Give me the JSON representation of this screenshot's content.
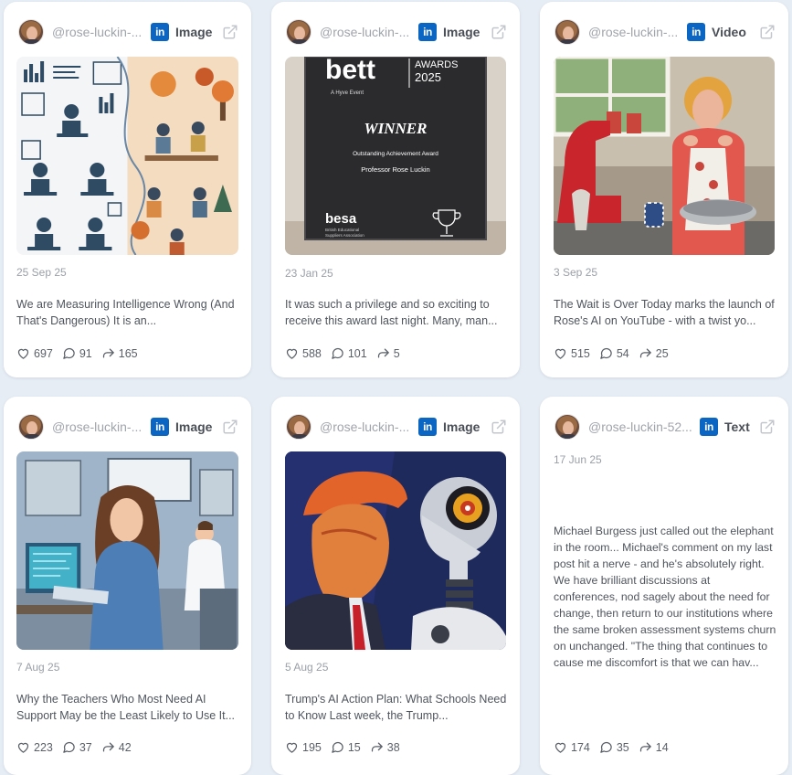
{
  "cards": [
    {
      "handle": "@rose-luckin-...",
      "platform_icon": "linkedin-icon",
      "type": "Image",
      "date": "25 Sep 25",
      "excerpt": "We are Measuring Intelligence Wrong (And That's Dangerous) It is an...",
      "likes": "697",
      "comments": "91",
      "shares": "165"
    },
    {
      "handle": "@rose-luckin-...",
      "platform_icon": "linkedin-icon",
      "type": "Image",
      "date": "23 Jan 25",
      "excerpt": "It was such a privilege and so exciting to receive this award last night. Many, man...",
      "likes": "588",
      "comments": "101",
      "shares": "5",
      "image_text": {
        "brand": "bett",
        "awards": "AWARDS",
        "year": "2025",
        "event": "A Hyve Event",
        "winner": "WINNER",
        "award": "Outstanding Achievement Award",
        "name": "Professor Rose Luckin",
        "sponsor": "besa",
        "sponsor_sub1": "British Educational",
        "sponsor_sub2": "Suppliers Association"
      }
    },
    {
      "handle": "@rose-luckin-...",
      "platform_icon": "linkedin-icon",
      "type": "Video",
      "date": "3 Sep 25",
      "excerpt": "The Wait is Over Today marks the launch of Rose's AI on YouTube - with a twist yo...",
      "likes": "515",
      "comments": "54",
      "shares": "25"
    },
    {
      "handle": "@rose-luckin-...",
      "platform_icon": "linkedin-icon",
      "type": "Image",
      "date": "7 Aug 25",
      "excerpt": "Why the Teachers Who Most Need AI Support May be the Least Likely to Use It...",
      "likes": "223",
      "comments": "37",
      "shares": "42"
    },
    {
      "handle": "@rose-luckin-...",
      "platform_icon": "linkedin-icon",
      "type": "Image",
      "date": "5 Aug 25",
      "excerpt": "Trump's AI Action Plan: What Schools Need to Know Last week, the Trump...",
      "likes": "195",
      "comments": "15",
      "shares": "38"
    },
    {
      "handle": "@rose-luckin-52...",
      "platform_icon": "linkedin-icon",
      "type": "Text",
      "date": "17 Jun 25",
      "excerpt": "Michael Burgess just called out the elephant in the room... Michael's comment on my last post hit a nerve - and he's absolutely right. We have brilliant discussions at conferences, nod sagely about the need for change, then return to our institutions where the same broken assessment systems churn on unchanged. \"The thing that continues to cause me discomfort is that we can hav...",
      "likes": "174",
      "comments": "35",
      "shares": "14"
    }
  ],
  "colors": {
    "linkedin": "#0a66c2",
    "background": "#e6edf5",
    "card": "#ffffff"
  }
}
